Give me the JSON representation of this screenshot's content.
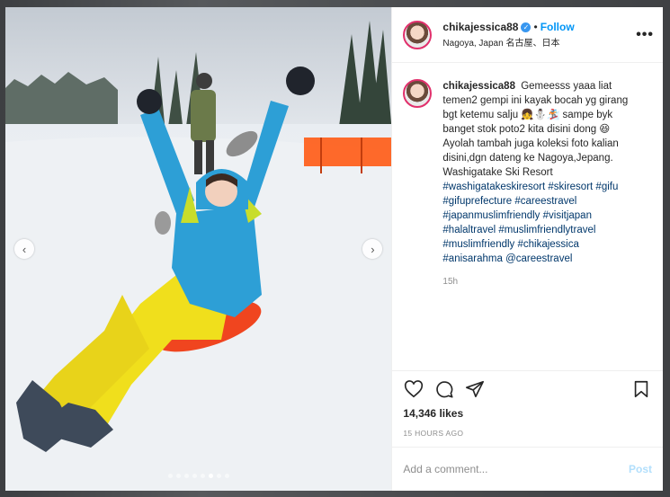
{
  "post": {
    "username": "chikajessica88",
    "verified_mark": "✓",
    "separator": "•",
    "follow_label": "Follow",
    "location": "Nagoya, Japan 名古屋、日本",
    "more_label": "•••"
  },
  "caption": {
    "username": "chikajessica88",
    "text": "Gemeesss yaaa liat temen2 gempi ini kayak bocah yg girang bgt ketemu salju 👧⛄🏂 sampe byk banget stok poto2 kita disini dong 😆 Ayolah tambah juga koleksi foto kalian disini,dgn dateng ke Nagoya,Jepang. Washigatake Ski Resort",
    "hashtags": "#washigatakeskiresort #skiresort #gifu #gifuprefecture #careestravel #japanmuslimfriendly #visitjapan #halaltravel #muslimfriendlytravel #muslimfriendly #chikajessica #anisarahma @careestravel",
    "time_ago": "15h"
  },
  "likes": "14,346 likes",
  "posted": "15 HOURS AGO",
  "comment": {
    "placeholder": "Add a comment...",
    "post_label": "Post"
  },
  "carousel": {
    "count": 8,
    "active_index": 5,
    "prev": "‹",
    "next": "›"
  },
  "colors": {
    "jacket": "#2d9fd6",
    "pants": "#f0df1c",
    "sled": "#f0451f",
    "fence": "#ff5a14",
    "link": "#00376b",
    "follow": "#0095f6"
  }
}
